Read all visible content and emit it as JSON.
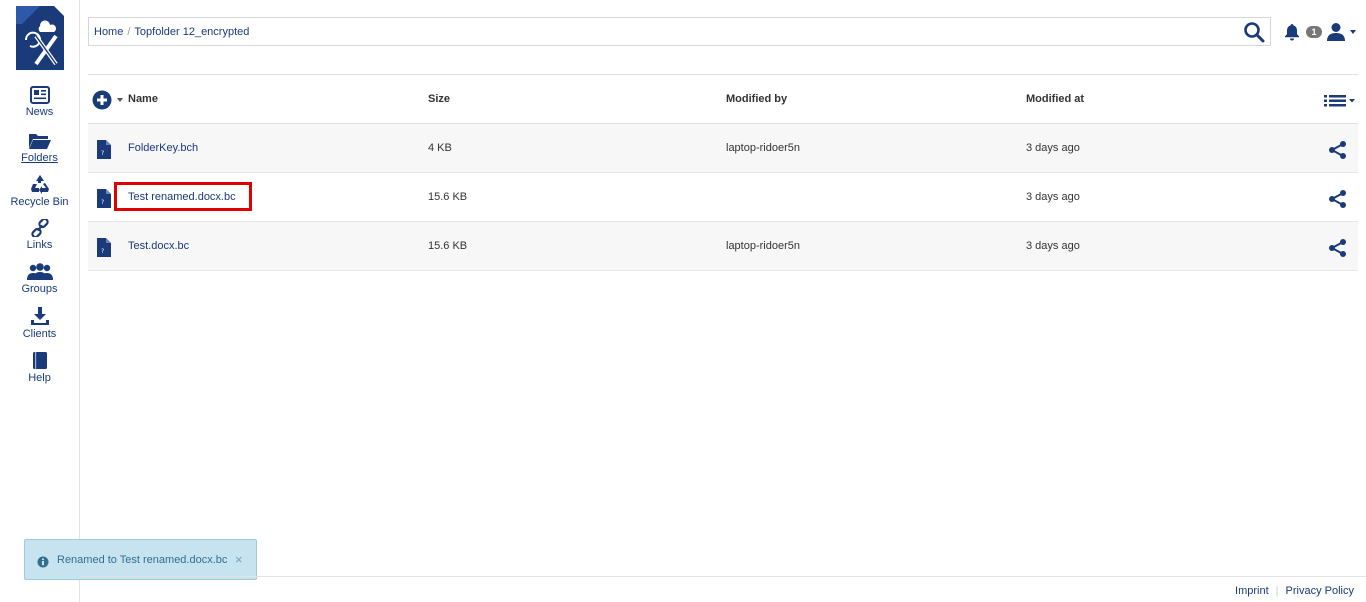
{
  "sidebar": {
    "items": [
      {
        "label": "News",
        "icon": "newspaper-icon"
      },
      {
        "label": "Folders",
        "icon": "folder-icon",
        "active": true
      },
      {
        "label": "Recycle Bin",
        "icon": "recycle-icon"
      },
      {
        "label": "Links",
        "icon": "link-icon"
      },
      {
        "label": "Groups",
        "icon": "users-icon"
      },
      {
        "label": "Clients",
        "icon": "download-icon"
      },
      {
        "label": "Help",
        "icon": "book-icon"
      }
    ]
  },
  "breadcrumb": {
    "home": "Home",
    "current": "Topfolder 12_encrypted"
  },
  "header": {
    "notification_count": "1"
  },
  "table": {
    "columns": {
      "name": "Name",
      "size": "Size",
      "modified_by": "Modified by",
      "modified_at": "Modified at"
    },
    "rows": [
      {
        "name": "FolderKey.bch",
        "size": "4 KB",
        "modified_by": "laptop-ridoer5n",
        "modified_at": "3 days ago"
      },
      {
        "name": "Test renamed.docx.bc",
        "size": "15.6 KB",
        "modified_by": "",
        "modified_at": "3 days ago"
      },
      {
        "name": "Test.docx.bc",
        "size": "15.6 KB",
        "modified_by": "laptop-ridoer5n",
        "modified_at": "3 days ago"
      }
    ]
  },
  "toast": {
    "message": "Renamed to Test renamed.docx.bc",
    "close": "×"
  },
  "footer": {
    "imprint": "Imprint",
    "privacy": "Privacy Policy"
  },
  "colors": {
    "brand": "#1a3a7a",
    "highlight": "#e00000",
    "toast_bg": "#c6e3ef"
  }
}
